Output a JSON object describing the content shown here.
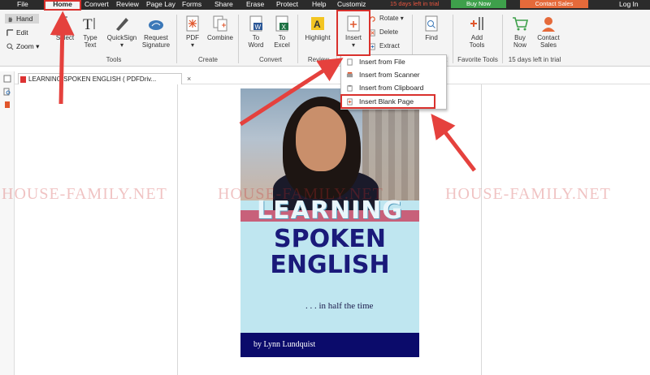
{
  "menu": {
    "file": "File",
    "home": "Home",
    "convert": "Convert",
    "review": "Review",
    "page_layout": "Page Lay",
    "forms": "Forms",
    "share": "Share",
    "erase": "Erase",
    "protect": "Protect",
    "help": "Help",
    "customize": "Customiz",
    "trial_text": "15 days left in trial",
    "buy_now": "Buy Now",
    "contact_sales": "Contact Sales",
    "login": "Log In"
  },
  "modes": {
    "hand": "Hand",
    "edit": "Edit",
    "zoom": "Zoom"
  },
  "ribbon": {
    "select": "Select",
    "type_text_1": "Type",
    "type_text_2": "Text",
    "quicksign": "QuickSign",
    "request_signature_1": "Request",
    "request_signature_2": "Signature",
    "tools_group": "Tools",
    "pdf": "PDF",
    "combine": "Combine",
    "create_group": "Create",
    "to_word_1": "To",
    "to_word_2": "Word",
    "to_excel_1": "To",
    "to_excel_2": "Excel",
    "convert_group": "Convert",
    "highlight": "Highlight",
    "review_group": "Review",
    "insert": "Insert",
    "rotate": "Rotate",
    "delete": "Delete",
    "extract": "Extract",
    "find": "Find",
    "find_group_partial": "nt",
    "add_tools_1": "Add",
    "add_tools_2": "Tools",
    "favorite_tools_group": "Favorite Tools",
    "buy_now_1": "Buy",
    "buy_now_2": "Now",
    "contact_sales_1": "Contact",
    "contact_sales_2": "Sales",
    "trial_group": "15 days left in trial"
  },
  "insert_menu": {
    "items": [
      "Insert from File",
      "Insert from Scanner",
      "Insert from Clipboard",
      "Insert Blank Page"
    ]
  },
  "document": {
    "tab_title": "LEARNING SPOKEN ENGLISH ( PDFDriv...",
    "close": "×"
  },
  "cover": {
    "learning": "LEARNING",
    "spoken": "SPOKEN",
    "english": "ENGLISH",
    "subtitle": ". . . in half the time",
    "author": "by Lynn Lundquist"
  },
  "watermark": {
    "text_1": "HOUSE-FAMILY.NET",
    "text_2": "HOUSE-FAMILY.NET",
    "text_3": "HOUSE-FAMILY.NET"
  },
  "colors": {
    "annotation_red": "#d9312d",
    "menubar_bg": "#2b2b2b",
    "buy_green": "#3ea04b",
    "contact_orange": "#e56a3a",
    "cover_navy": "#1a1a7a"
  }
}
